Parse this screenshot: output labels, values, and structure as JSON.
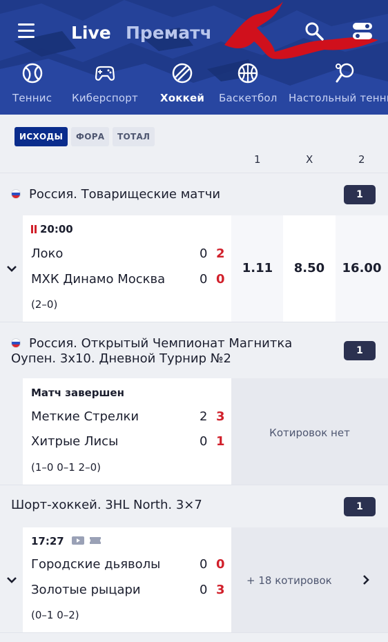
{
  "header": {
    "live_tab": "Live",
    "prematch_tab": "Прематч",
    "accent": "#1f3a8a",
    "icons": [
      "menu-icon",
      "search-icon",
      "settings-toggle-icon"
    ]
  },
  "sports": [
    {
      "label": "Теннис",
      "icon": "tennis-ball-icon",
      "active": false
    },
    {
      "label": "Киберспорт",
      "icon": "gamepad-icon",
      "active": false
    },
    {
      "label": "Хоккей",
      "icon": "hockey-puck-icon",
      "active": true
    },
    {
      "label": "Баскетбол",
      "icon": "basketball-icon",
      "active": false
    },
    {
      "label": "Настольный теннис",
      "icon": "table-tennis-icon",
      "active": false
    }
  ],
  "filters": {
    "chips": [
      "ИСХОДЫ",
      "ФОРА",
      "ТОТАЛ"
    ],
    "active_chip": "ИСХОДЫ",
    "columns": [
      "1",
      "X",
      "2"
    ]
  },
  "leagues": [
    {
      "title": "Россия. Товарищеские матчи",
      "count": "1",
      "match": {
        "time": "20:00",
        "team1": "Локо",
        "score1a": "0",
        "score1b": "2",
        "team2": "МХК Динамо Москва",
        "score2a": "0",
        "score2b": "0",
        "periods": "(2–0)",
        "odds": [
          "1.11",
          "8.50",
          "16.00"
        ]
      }
    },
    {
      "title_line1": "Россия. Открытый Чемпионат Магнитка",
      "title_line2": "Оупен. 3х10. Дневной Турнир №2",
      "count": "1",
      "match": {
        "status": "Матч завершен",
        "team1": "Меткие Стрелки",
        "score1a": "2",
        "score1b": "3",
        "team2": "Хитрые Лисы",
        "score2a": "0",
        "score2b": "1",
        "periods": "(1–0 0–1 2–0)",
        "no_odds": "Котировок нет"
      }
    },
    {
      "title": "Шорт-хоккей. 3HL North. 3×7",
      "count": "1",
      "match": {
        "time": "17:27",
        "team1": "Городские дьяволы",
        "score1a": "0",
        "score1b": "0",
        "team2": "Золотые рыцари",
        "score2a": "0",
        "score2b": "3",
        "periods": "(0–1 0–2)",
        "more_odds": "+ 18 котировок"
      }
    }
  ]
}
